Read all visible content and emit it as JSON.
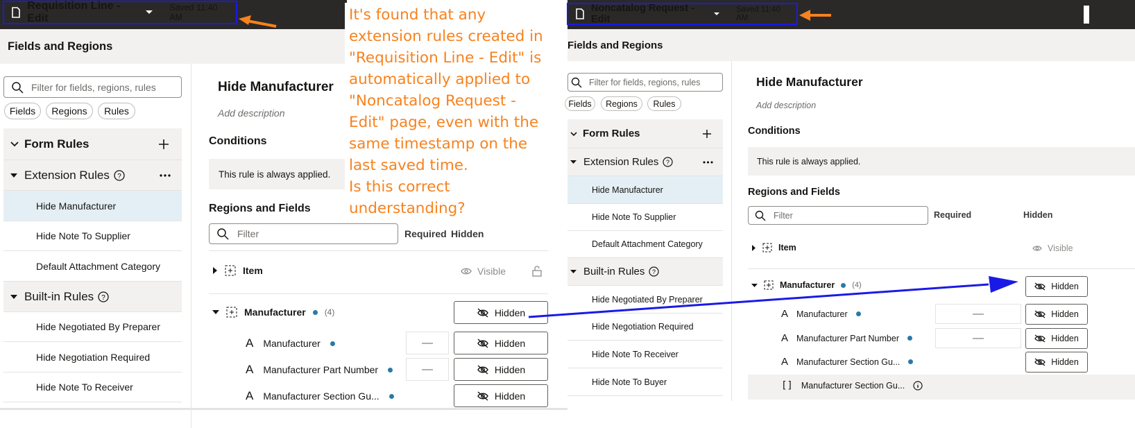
{
  "left": {
    "title": "Requisition Line - Edit",
    "saved": "Saved 11:40 AM",
    "panel_title": "Fields and Regions",
    "search_placeholder": "Filter for fields, regions, rules",
    "chips": [
      "Fields",
      "Regions",
      "Rules"
    ],
    "form_rules": "Form Rules",
    "extension_rules": "Extension Rules",
    "ext_items": [
      "Hide Manufacturer",
      "Hide Note To Supplier",
      "Default Attachment Category"
    ],
    "builtin_rules": "Built-in Rules",
    "builtin_items": [
      "Hide Negotiated By Preparer",
      "Hide Negotiation Required",
      "Hide Note To Receiver"
    ],
    "rule_title": "Hide Manufacturer",
    "add_description": "Add description",
    "conditions": "Conditions",
    "always_applied": "This rule is always applied.",
    "regions_fields": "Regions and Fields",
    "filter_placeholder": "Filter",
    "col_required": "Required",
    "col_hidden": "Hidden",
    "item_label": "Item",
    "visible_label": "Visible",
    "manufacturer_region": "Manufacturer",
    "manufacturer_count": "(4)",
    "hidden_label": "Hidden",
    "dash": "—",
    "fields": [
      "Manufacturer",
      "Manufacturer Part Number",
      "Manufacturer Section Gu..."
    ]
  },
  "right": {
    "title": "Noncatalog Request - Edit",
    "saved": "Saved 11:40 AM",
    "panel_title": "Fields and Regions",
    "search_placeholder": "Filter for fields, regions, rules",
    "chips": [
      "Fields",
      "Regions",
      "Rules"
    ],
    "form_rules": "Form Rules",
    "extension_rules": "Extension Rules",
    "ext_items": [
      "Hide Manufacturer",
      "Hide Note To Supplier",
      "Default Attachment Category"
    ],
    "builtin_rules": "Built-in Rules",
    "builtin_items": [
      "Hide Negotiated By Preparer",
      "Hide Negotiation Required",
      "Hide Note To Receiver",
      "Hide Note To Buyer"
    ],
    "rule_title": "Hide Manufacturer",
    "add_description": "Add description",
    "conditions": "Conditions",
    "always_applied": "This rule is always applied.",
    "regions_fields": "Regions and Fields",
    "filter_placeholder": "Filter",
    "col_required": "Required",
    "col_hidden": "Hidden",
    "item_label": "Item",
    "visible_label": "Visible",
    "manufacturer_region": "Manufacturer",
    "manufacturer_count": "(4)",
    "hidden_label": "Hidden",
    "dash": "—",
    "fields": [
      "Manufacturer",
      "Manufacturer Part Number",
      "Manufacturer Section Gu...",
      "Manufacturer Section Gu..."
    ]
  },
  "annotation": {
    "lines": [
      "It's found that any",
      "extension rules created in",
      "\"Requisition Line - Edit\" is",
      "automatically applied to",
      "\"Noncatalog Request -",
      "Edit\" page, even with the",
      "same timestamp on the",
      "last saved time.",
      "Is this correct",
      "understanding?"
    ]
  },
  "colors": {
    "annotation": "#f7821e",
    "highlight_box": "#1a1ae6",
    "topbar": "#2a2928"
  }
}
